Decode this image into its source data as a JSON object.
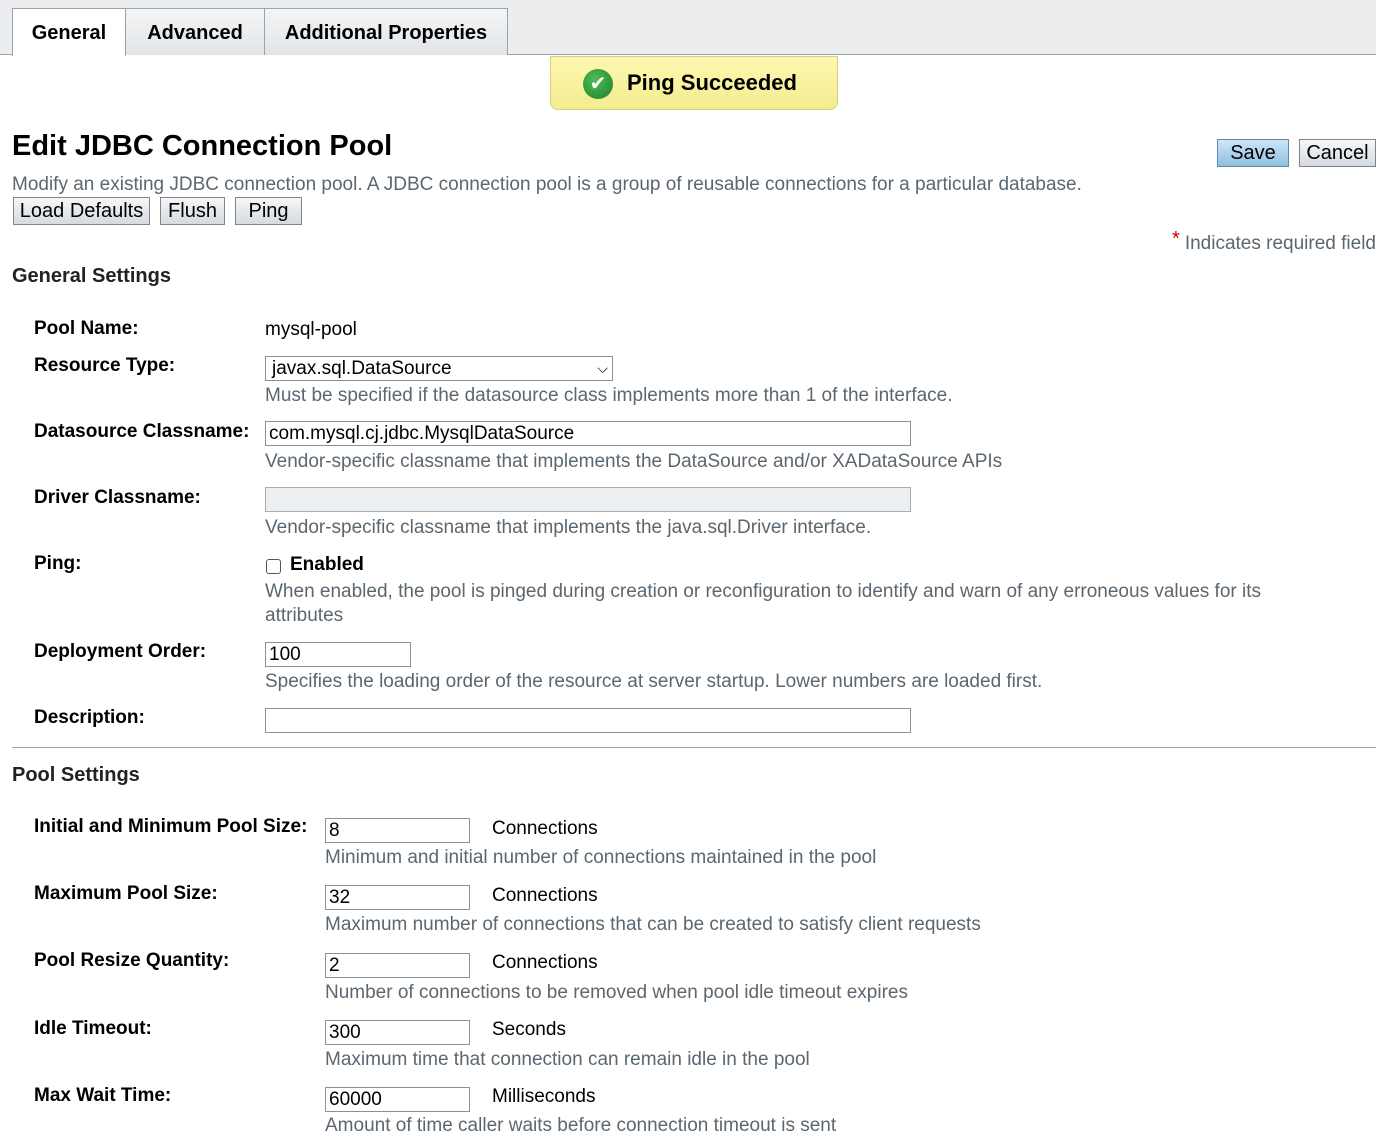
{
  "tabs": [
    "General",
    "Advanced",
    "Additional Properties"
  ],
  "notification": {
    "text": "Ping Succeeded",
    "icon": "check-circle-icon"
  },
  "page": {
    "title": "Edit JDBC Connection Pool",
    "description": "Modify an existing JDBC connection pool. A JDBC connection pool is a group of reusable connections for a particular database."
  },
  "actions": {
    "save": "Save",
    "cancel": "Cancel",
    "load_defaults": "Load Defaults",
    "flush": "Flush",
    "ping": "Ping"
  },
  "required_note": {
    "star": "*",
    "text": "Indicates required field"
  },
  "general": {
    "title": "General Settings",
    "pool_name": {
      "label": "Pool Name:",
      "value": "mysql-pool"
    },
    "resource_type": {
      "label": "Resource Type:",
      "value": "javax.sql.DataSource",
      "help": "Must be specified if the datasource class implements more than 1 of the interface."
    },
    "datasource_classname": {
      "label": "Datasource Classname:",
      "value": "com.mysql.cj.jdbc.MysqlDataSource",
      "help": "Vendor-specific classname that implements the DataSource and/or XADataSource APIs"
    },
    "driver_classname": {
      "label": "Driver Classname:",
      "value": "",
      "help": "Vendor-specific classname that implements the java.sql.Driver interface."
    },
    "ping": {
      "label": "Ping:",
      "checkbox_label": "Enabled",
      "checked": false,
      "help": "When enabled, the pool is pinged during creation or reconfiguration to identify and warn of any erroneous values for its attributes"
    },
    "deployment_order": {
      "label": "Deployment Order:",
      "value": "100",
      "help": "Specifies the loading order of the resource at server startup. Lower numbers are loaded first."
    },
    "description": {
      "label": "Description:",
      "value": ""
    }
  },
  "pool": {
    "title": "Pool Settings",
    "initial_min_size": {
      "label": "Initial and Minimum Pool Size:",
      "value": "8",
      "unit": "Connections",
      "help": "Minimum and initial number of connections maintained in the pool"
    },
    "max_size": {
      "label": "Maximum Pool Size:",
      "value": "32",
      "unit": "Connections",
      "help": "Maximum number of connections that can be created to satisfy client requests"
    },
    "resize_quantity": {
      "label": "Pool Resize Quantity:",
      "value": "2",
      "unit": "Connections",
      "help": "Number of connections to be removed when pool idle timeout expires"
    },
    "idle_timeout": {
      "label": "Idle Timeout:",
      "value": "300",
      "unit": "Seconds",
      "help": "Maximum time that connection can remain idle in the pool"
    },
    "max_wait_time": {
      "label": "Max Wait Time:",
      "value": "60000",
      "unit": "Milliseconds",
      "help": "Amount of time caller waits before connection timeout is sent"
    }
  }
}
